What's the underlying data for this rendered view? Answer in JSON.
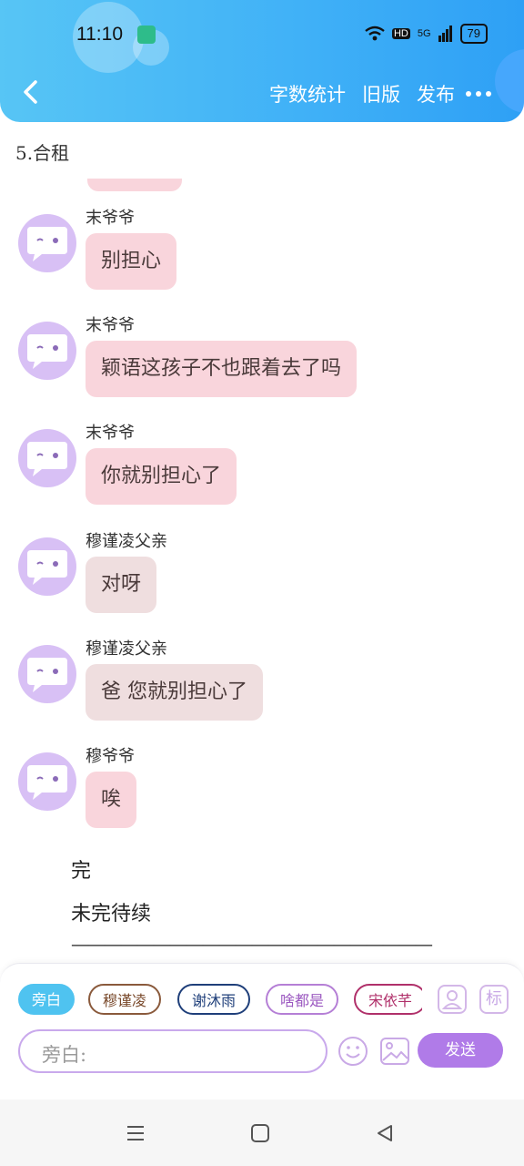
{
  "status_bar": {
    "time": "11:10",
    "network": "5G",
    "hd": "HD",
    "battery": "79"
  },
  "nav": {
    "actions": [
      "字数统计",
      "旧版",
      "发布"
    ]
  },
  "chapter": {
    "title": "5.合租"
  },
  "messages": [
    {
      "sender": "末爷爷",
      "text": "别担心",
      "style": "pink"
    },
    {
      "sender": "末爷爷",
      "text": "颖语这孩子不也跟着去了吗",
      "style": "pink"
    },
    {
      "sender": "末爷爷",
      "text": "你就别担心了",
      "style": "pink"
    },
    {
      "sender": "穆谨凌父亲",
      "text": "对呀",
      "style": "beige"
    },
    {
      "sender": "穆谨凌父亲",
      "text": "爸 您就别担心了",
      "style": "beige"
    },
    {
      "sender": "穆爷爷",
      "text": "唉",
      "style": "pink"
    }
  ],
  "narration": [
    "完",
    "未完待续"
  ],
  "divider": "——————————————————————",
  "composer": {
    "chips": [
      {
        "label": "旁白",
        "color": "#ffffff",
        "bg": "#4fc3f0",
        "border": "#4fc3f0"
      },
      {
        "label": "穆谨凌",
        "color": "#7a4a2c",
        "bg": "#ffffff",
        "border": "#8a5a3c"
      },
      {
        "label": "谢沐雨",
        "color": "#1f3f7a",
        "bg": "#ffffff",
        "border": "#1f3f7a"
      },
      {
        "label": "啥都是",
        "color": "#9b58c0",
        "bg": "#ffffff",
        "border": "#b57fd6"
      },
      {
        "label": "宋依芊",
        "color": "#b0306a",
        "bg": "#ffffff",
        "border": "#b0306a"
      }
    ],
    "avatar_btn_icon": "user-icon",
    "tag_btn_label": "标",
    "placeholder": "旁白:",
    "send_label": "发送"
  },
  "colors": {
    "header": "#3fb0f7",
    "accent": "#b07be8",
    "bubble_pink": "#f9d5dc",
    "bubble_beige": "#efdedf"
  }
}
